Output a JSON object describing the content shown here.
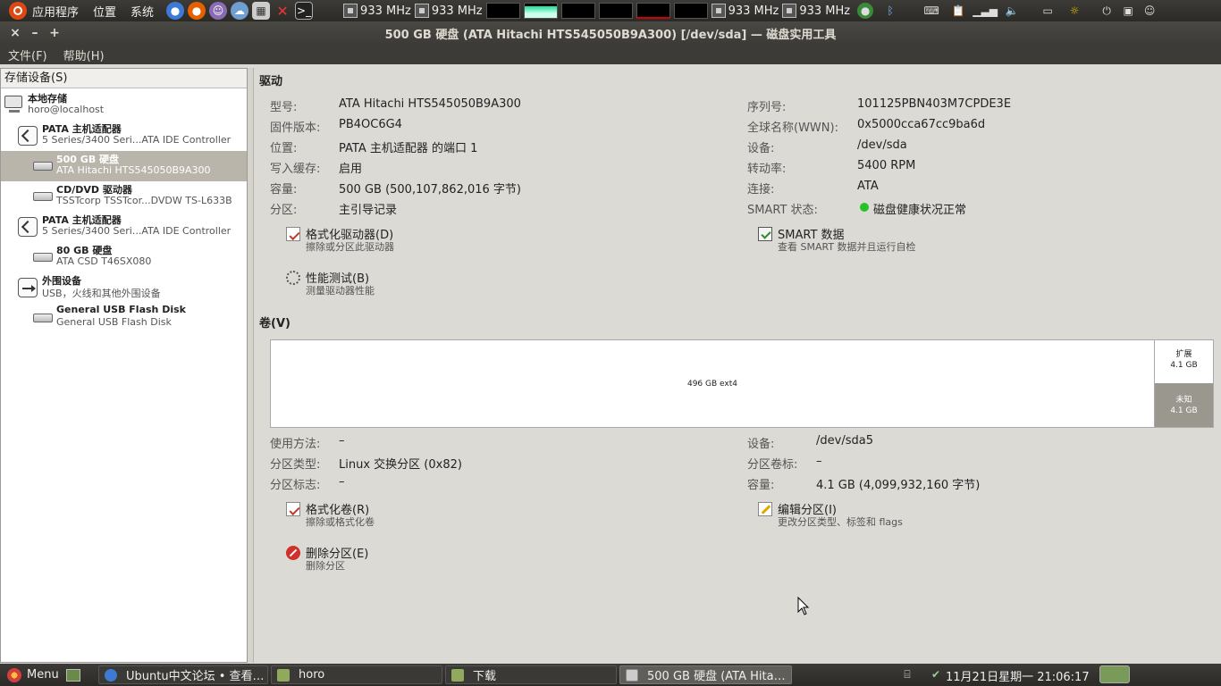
{
  "top_panel": {
    "menus": [
      "应用程序",
      "位置",
      "系统"
    ],
    "cpu": [
      "933 MHz",
      "933 MHz",
      "933 MHz",
      "933 MHz"
    ]
  },
  "window": {
    "title": "500 GB 硬盘 (ATA Hitachi HTS545050B9A300) [/dev/sda] — 磁盘实用工具",
    "controls": [
      "×",
      "–",
      "+"
    ]
  },
  "menubar": {
    "file": "文件(F)",
    "help": "帮助(H)"
  },
  "sidebar": {
    "header": "存储设备(S)",
    "items": [
      {
        "title": "本地存储",
        "subtitle": "horo@localhost",
        "icon": "computer-icon"
      },
      {
        "title": "PATA 主机适配器",
        "subtitle": "5 Series/3400 Seri...ATA IDE Controller",
        "icon": "adapter-icon"
      },
      {
        "title": "500 GB 硬盘",
        "subtitle": "ATA Hitachi HTS545050B9A300",
        "icon": "disk-icon",
        "selected": true
      },
      {
        "title": "CD/DVD 驱动器",
        "subtitle": "TSSTcorp TSSTcor...DVDW TS-L633B",
        "icon": "optical-drive-icon"
      },
      {
        "title": "PATA 主机适配器",
        "subtitle": "5 Series/3400 Seri...ATA IDE Controller",
        "icon": "adapter-icon"
      },
      {
        "title": "80 GB 硬盘",
        "subtitle": "ATA CSD T46SX080",
        "icon": "disk-icon"
      },
      {
        "title": "外围设备",
        "subtitle": "USB，火线和其他外围设备",
        "icon": "usb-icon"
      },
      {
        "title": "General USB Flash Disk",
        "subtitle": "General USB Flash Disk",
        "icon": "flash-disk-icon"
      }
    ]
  },
  "drive": {
    "title": "驱动",
    "left": [
      {
        "label": "型号:",
        "value": "ATA Hitachi HTS545050B9A300"
      },
      {
        "label": "固件版本:",
        "value": "PB4OC6G4"
      },
      {
        "label": "位置:",
        "value": "PATA 主机适配器 的端口 1"
      },
      {
        "label": "写入缓存:",
        "value": "启用"
      },
      {
        "label": "容量:",
        "value": "500 GB (500,107,862,016 字节)"
      },
      {
        "label": "分区:",
        "value": "主引导记录"
      }
    ],
    "right": [
      {
        "label": "序列号:",
        "value": "101125PBN403M7CPDE3E"
      },
      {
        "label": "全球名称(WWN):",
        "value": "0x5000cca67cc9ba6d"
      },
      {
        "label": "设备:",
        "value": "/dev/sda"
      },
      {
        "label": "转动率:",
        "value": "5400 RPM"
      },
      {
        "label": "连接:",
        "value": "ATA"
      },
      {
        "label": "SMART 状态:",
        "value": "磁盘健康状况正常"
      }
    ],
    "actions": {
      "format": {
        "title": "格式化驱动器(D)",
        "desc": "擦除或分区此驱动器"
      },
      "smart": {
        "title": "SMART 数据",
        "desc": "查看 SMART 数据并且运行自检"
      },
      "bench": {
        "title": "性能测试(B)",
        "desc": "测量驱动器性能"
      }
    }
  },
  "volumes": {
    "title": "卷(V)",
    "main": "496 GB ext4",
    "extended": {
      "name": "扩展",
      "size": "4.1 GB"
    },
    "unknown": {
      "name": "未知",
      "size": "4.1 GB"
    },
    "left": [
      {
        "label": "使用方法:",
        "value": "–"
      },
      {
        "label": "分区类型:",
        "value": "Linux 交换分区 (0x82)"
      },
      {
        "label": "分区标志:",
        "value": "–"
      }
    ],
    "right": [
      {
        "label": "设备:",
        "value": "/dev/sda5"
      },
      {
        "label": "分区卷标:",
        "value": "–"
      },
      {
        "label": "容量:",
        "value": "4.1 GB (4,099,932,160 字节)"
      }
    ],
    "actions": {
      "format": {
        "title": "格式化卷(R)",
        "desc": "擦除或格式化卷"
      },
      "edit": {
        "title": "编辑分区(I)",
        "desc": "更改分区类型、标签和 flags"
      },
      "delete": {
        "title": "删除分区(E)",
        "desc": "删除分区"
      }
    }
  },
  "taskbar": {
    "menu": "Menu",
    "tasks": [
      "Ubuntu中文论坛 • 查看…",
      "horo",
      "下载",
      "500 GB 硬盘 (ATA Hita…"
    ],
    "clock": "11月21日星期一 21:06:17"
  }
}
